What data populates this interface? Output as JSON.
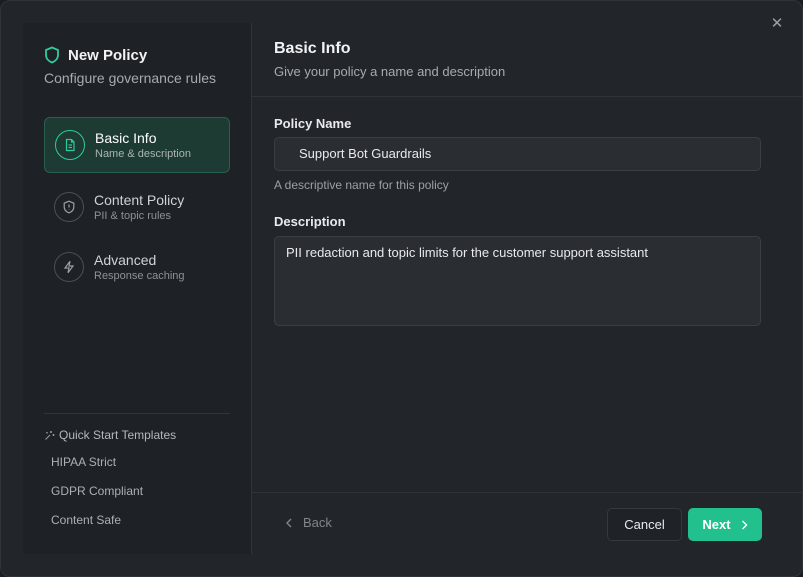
{
  "dialog": {
    "close_icon": "close-icon"
  },
  "sidebar": {
    "title": "New Policy",
    "subtitle": "Configure governance rules",
    "steps": [
      {
        "label": "Basic Info",
        "description": "Name & description",
        "icon": "document-icon",
        "active": true
      },
      {
        "label": "Content Policy",
        "description": "PII & topic rules",
        "icon": "shield-alert-icon",
        "active": false
      },
      {
        "label": "Advanced",
        "description": "Response caching",
        "icon": "lightning-icon",
        "active": false
      }
    ],
    "quick_start": {
      "title": "Quick Start Templates",
      "items": [
        "HIPAA Strict",
        "GDPR Compliant",
        "Content Safe"
      ]
    }
  },
  "main": {
    "title": "Basic Info",
    "subtitle": "Give your policy a name and description",
    "policy_name": {
      "label": "Policy Name",
      "value": "Support Bot Guardrails",
      "help": "A descriptive name for this policy"
    },
    "description": {
      "label": "Description",
      "value": "PII redaction and topic limits for the customer support assistant"
    }
  },
  "footer": {
    "back_label": "Back",
    "cancel_label": "Cancel",
    "next_label": "Next"
  },
  "colors": {
    "accent": "#22c08c",
    "background": "#22262b",
    "sidebar": "#1e2226"
  }
}
